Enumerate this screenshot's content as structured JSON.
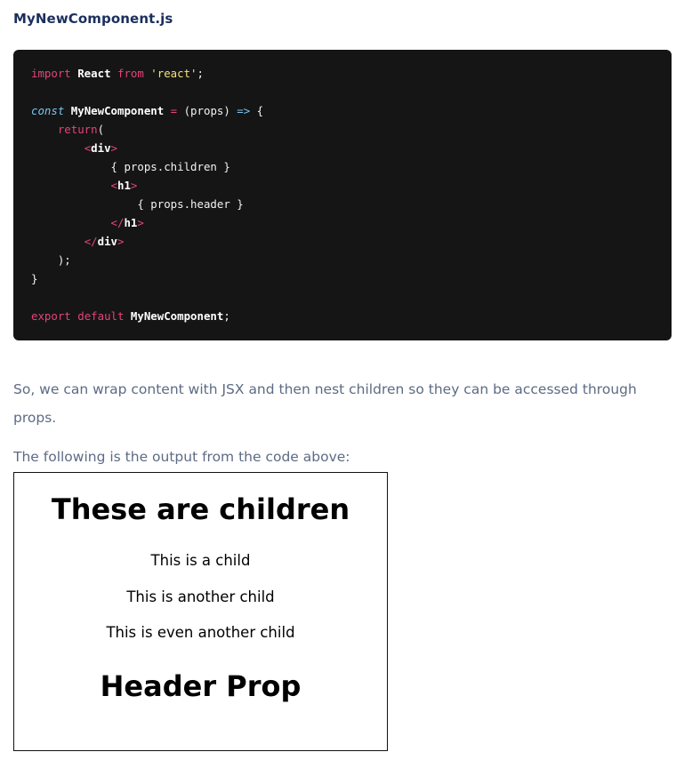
{
  "filename": "MyNewComponent.js",
  "code": {
    "line1": {
      "k1": "import",
      "id1": " React ",
      "k2": "from",
      "sp": " ",
      "s1": "'react'",
      "end": ";"
    },
    "line3": {
      "k1": "const",
      "id1": " MyNewComponent ",
      "op": "=",
      "args": " (props) ",
      "arrow": "=>",
      "brace": " {"
    },
    "line4": {
      "indent": "    ",
      "k1": "return",
      "p1": "("
    },
    "line5": {
      "indent": "        ",
      "lt": "<",
      "tag": "div",
      "gt": ">"
    },
    "line6": {
      "indent": "            ",
      "text": "{ props.children }"
    },
    "line7": {
      "indent": "            ",
      "lt": "<",
      "tag": "h1",
      "gt": ">"
    },
    "line8": {
      "indent": "                ",
      "text": "{ props.header }"
    },
    "line9": {
      "indent": "            ",
      "lt": "</",
      "tag": "h1",
      "gt": ">"
    },
    "line10": {
      "indent": "        ",
      "lt": "</",
      "tag": "div",
      "gt": ">"
    },
    "line11": {
      "text": "    );"
    },
    "line12": {
      "text": "}"
    },
    "line14": {
      "k1": "export",
      "sp": " ",
      "k2": "default",
      "id1": " MyNewComponent",
      "end": ";"
    }
  },
  "paragraph1": "So, we can wrap content with JSX and then nest children so they can be accessed through props.",
  "paragraph2": "The following is the output from the code above:",
  "output": {
    "heading1": "These are children",
    "child1": "This is a child",
    "child2": "This is another child",
    "child3": "This is even another child",
    "heading2": "Header Prop"
  }
}
